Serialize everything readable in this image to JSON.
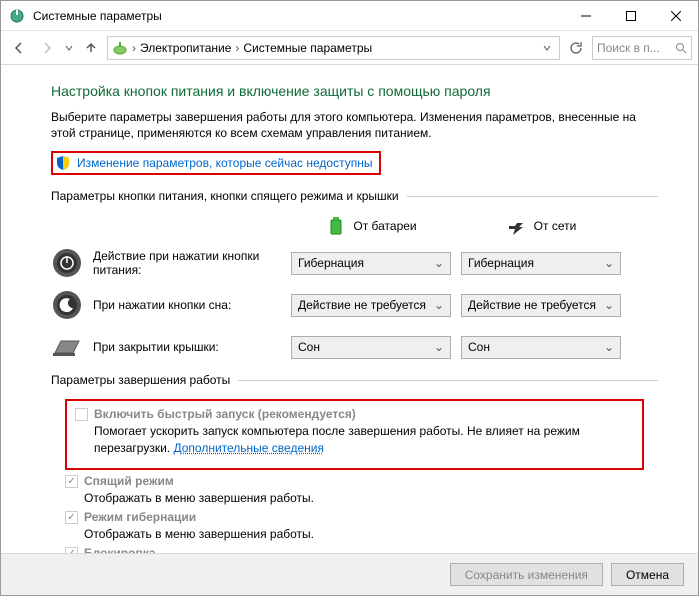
{
  "window": {
    "title": "Системные параметры"
  },
  "address": {
    "seg1": "Электропитание",
    "seg2": "Системные параметры"
  },
  "search": {
    "placeholder": "Поиск в п..."
  },
  "page": {
    "title": "Настройка кнопок питания и включение защиты с помощью пароля",
    "description": "Выберите параметры завершения работы для этого компьютера. Изменения параметров, внесенные на этой странице, применяются ко всем схемам управления питанием.",
    "unlock_link": "Изменение параметров, которые сейчас недоступны"
  },
  "section1": {
    "header": "Параметры кнопки питания, кнопки спящего режима и крышки",
    "col_battery": "От батареи",
    "col_ac": "От сети",
    "rows": [
      {
        "label": "Действие при нажатии кнопки питания:",
        "battery": "Гибернация",
        "ac": "Гибернация"
      },
      {
        "label": "При нажатии кнопки сна:",
        "battery": "Действие не требуется",
        "ac": "Действие не требуется"
      },
      {
        "label": "При закрытии крышки:",
        "battery": "Сон",
        "ac": "Сон"
      }
    ]
  },
  "section2": {
    "header": "Параметры завершения работы",
    "fast": {
      "label": "Включить быстрый запуск (рекомендуется)",
      "desc_pre": "Помогает ускорить запуск компьютера после завершения работы. Не влияет на режим перезагрузки. ",
      "link": "Дополнительные сведения"
    },
    "items": [
      {
        "label": "Спящий режим",
        "desc": "Отображать в меню завершения работы."
      },
      {
        "label": "Режим гибернации",
        "desc": "Отображать в меню завершения работы."
      },
      {
        "label": "Блокировка",
        "desc": ""
      }
    ]
  },
  "footer": {
    "save": "Сохранить изменения",
    "cancel": "Отмена"
  }
}
